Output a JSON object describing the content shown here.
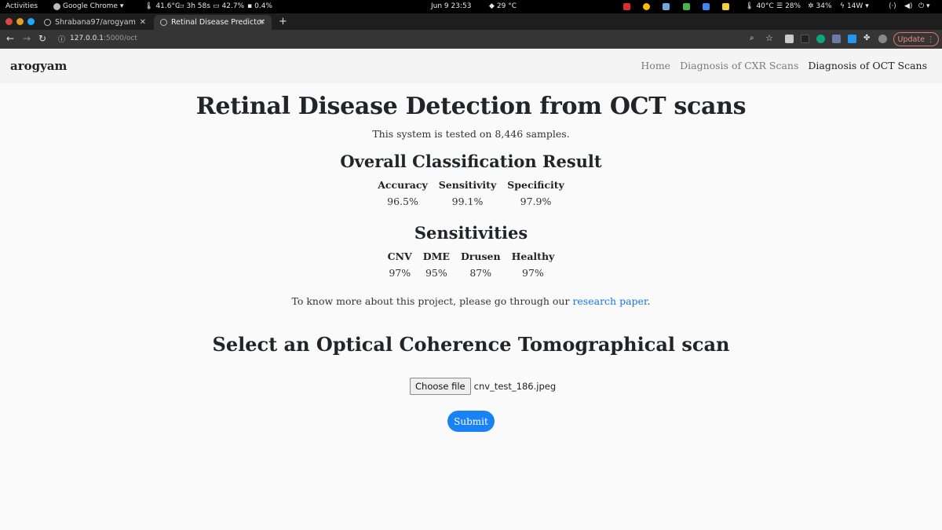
{
  "os_bar": {
    "activities": "Activities",
    "app_menu": "Google Chrome",
    "temp_cpu": "41.6°C",
    "uptime": "3h 58s",
    "mem": "42.7%",
    "swap": "0.4%",
    "clock": "Jun 9  23:53",
    "weather": "29 °C",
    "gpu_temp": "40°C",
    "disk": "28%",
    "fan": "34%",
    "power": "14W"
  },
  "tabs": [
    {
      "label": "Shrabana97/arogyam"
    },
    {
      "label": "Retinal Disease Predictor"
    }
  ],
  "url": {
    "host": "127.0.0.1",
    "path": ":5000/oct"
  },
  "update_label": "Update",
  "navbar": {
    "brand": "arogyam",
    "links": [
      "Home",
      "Diagnosis of CXR Scans",
      "Diagnosis of OCT Scans"
    ]
  },
  "main": {
    "title": "Retinal Disease Detection from OCT scans",
    "subtitle": "This system is tested on 8,446 samples.",
    "overall_heading": "Overall Classification Result",
    "overall": [
      {
        "label": "Accuracy",
        "value": "96.5%"
      },
      {
        "label": "Sensitivity",
        "value": "99.1%"
      },
      {
        "label": "Specificity",
        "value": "97.9%"
      }
    ],
    "sens_heading": "Sensitivities",
    "sensitivities": [
      {
        "label": "CNV",
        "value": "97%"
      },
      {
        "label": "DME",
        "value": "95%"
      },
      {
        "label": "Drusen",
        "value": "87%"
      },
      {
        "label": "Healthy",
        "value": "97%"
      }
    ],
    "note_prefix": "To know more about this project, please go through our ",
    "note_link": "research paper",
    "note_suffix": ".",
    "select_heading": "Select an Optical Coherence Tomographical scan",
    "choose_label": "Choose file",
    "file_name": "cnv_test_186.jpeg",
    "submit_label": "Submit"
  }
}
